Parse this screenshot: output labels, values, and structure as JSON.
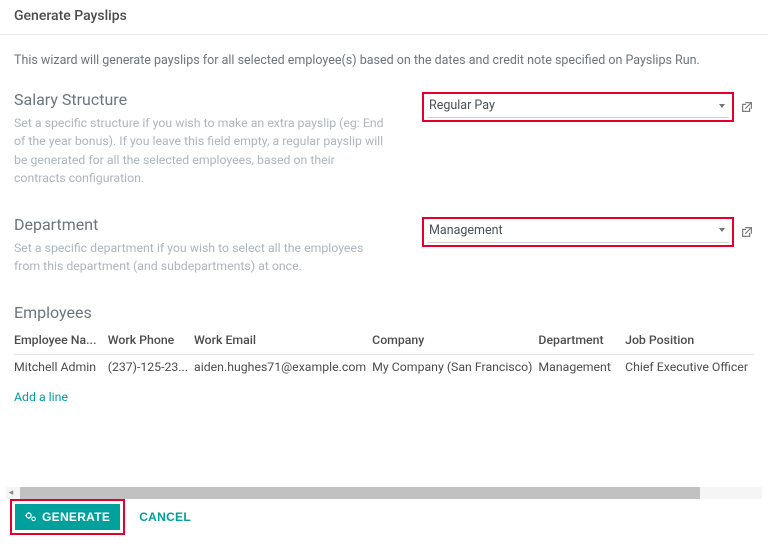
{
  "header": {
    "title": "Generate Payslips"
  },
  "intro": "This wizard will generate payslips for all selected employee(s) based on the dates and credit note specified on Payslips Run.",
  "salary": {
    "title": "Salary Structure",
    "help": "Set a specific structure if you wish to make an extra payslip (eg: End of the year bonus). If you leave this field empty, a regular payslip will be generated for all the selected employees, based on their contracts configuration.",
    "value": "Regular Pay"
  },
  "department": {
    "title": "Department",
    "help": "Set a specific department if you wish to select all the employees from this department (and subdepartments) at once.",
    "value": "Management"
  },
  "employees": {
    "title": "Employees",
    "columns": {
      "name": "Employee Na...",
      "phone": "Work Phone",
      "email": "Work Email",
      "company": "Company",
      "department": "Department",
      "job": "Job Position"
    },
    "rows": [
      {
        "name": "Mitchell Admin",
        "phone": "(237)-125-23...",
        "email": "aiden.hughes71@example.com",
        "company": "My Company (San Francisco)",
        "department": "Management",
        "job": "Chief Executive Officer"
      }
    ],
    "add_line": "Add a line"
  },
  "footer": {
    "generate": "Generate",
    "cancel": "Cancel"
  }
}
